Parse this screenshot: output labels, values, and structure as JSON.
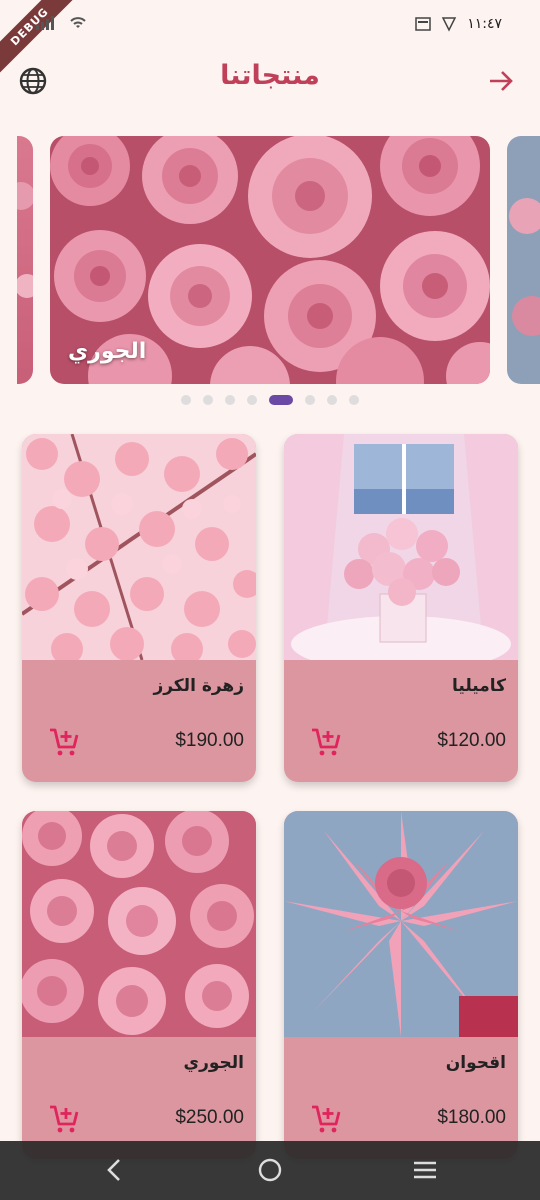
{
  "status": {
    "time": "١١:٤٧",
    "debug_label": "DEBUG"
  },
  "header": {
    "title": "منتجاتنا"
  },
  "carousel": {
    "caption": "الجوري",
    "active_index": 4,
    "dot_count": 8
  },
  "products": [
    {
      "name": "كاميليا",
      "price": "$120.00"
    },
    {
      "name": "زهرة الكرز",
      "price": "$190.00"
    },
    {
      "name": "اقحوان",
      "price": "$180.00"
    },
    {
      "name": "الجوري",
      "price": "$250.00"
    }
  ],
  "colors": {
    "accent": "#c0405a",
    "card_bg": "#dc96a0",
    "page_bg": "#fdf3f0",
    "indicator": "#6a4aa5",
    "cart": "#e0245e"
  },
  "icons": [
    "globe-icon",
    "arrow-right-icon",
    "add-cart-icon",
    "back-icon",
    "home-icon",
    "recents-icon"
  ]
}
